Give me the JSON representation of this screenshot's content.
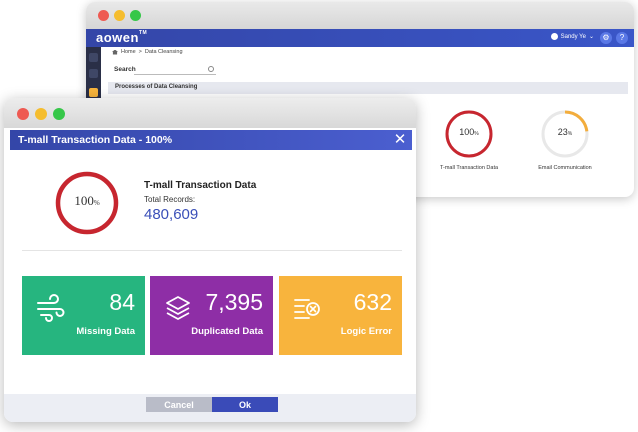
{
  "back_window": {
    "brand": "aowen",
    "brand_tm": "TM",
    "user_name": "Sandy Ye",
    "breadcrumb": {
      "home": "Home",
      "separator": ">",
      "current": "Data Cleansing"
    },
    "search_label": "Search",
    "search_placeholder": "",
    "section_title": "Processes of Data Cleansing",
    "cards": [
      {
        "percent": "100",
        "unit": "%",
        "label": "T-mall Transaction Data",
        "value": 1.0,
        "color": "#c7262f"
      },
      {
        "percent": "23",
        "unit": "%",
        "label": "Email Communication",
        "value": 0.23,
        "color": "#f3ad3c"
      }
    ]
  },
  "dialog": {
    "title": "T-mall Transaction Data - 100%",
    "close_symbol": "✕",
    "progress": {
      "percent": "100",
      "unit": "%",
      "value": 1.0,
      "color": "#c7262f"
    },
    "summary": {
      "name": "T-mall Transaction Data",
      "total_label": "Total Records:",
      "total_value": "480,609"
    },
    "stats": [
      {
        "value": "84",
        "label": "Missing Data",
        "color": "#26b57f",
        "icon": "wind-icon"
      },
      {
        "value": "7,395",
        "label": "Duplicated Data",
        "color": "#8e2ea6",
        "icon": "layers-icon"
      },
      {
        "value": "632",
        "label": "Logic Error",
        "color": "#f8b43d",
        "icon": "error-list-icon"
      }
    ],
    "buttons": {
      "cancel": "Cancel",
      "ok": "Ok"
    }
  }
}
